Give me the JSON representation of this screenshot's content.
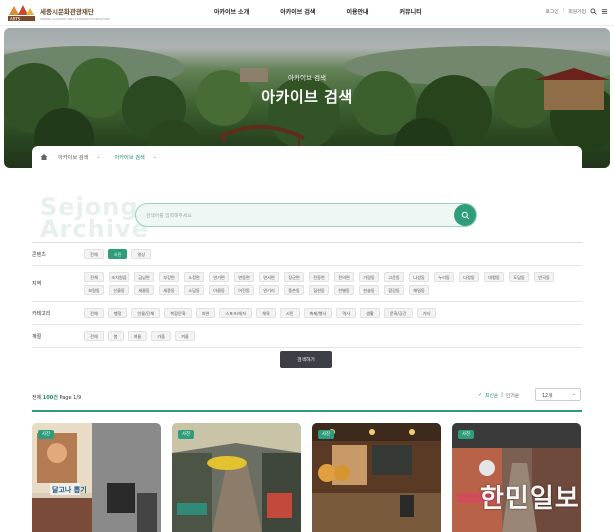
{
  "header": {
    "logo_title": "세종시문화관광재단",
    "logo_sub": "SEJONG CULTURE AND TOURISM FOUNDATION",
    "nav": [
      "아카이브 소개",
      "아카이브 검색",
      "이용안내",
      "커뮤니티"
    ],
    "login": "로그인",
    "join": "회원가입"
  },
  "hero": {
    "small": "아카이브 검색",
    "title": "아카이브 검색"
  },
  "breadcrumb": {
    "level1": "아카이브 검색",
    "level2": "아카이브 검색"
  },
  "watermark": [
    "Sejong",
    "Archive"
  ],
  "search": {
    "placeholder": "검색어를 입력해주세요"
  },
  "filters": {
    "content": {
      "label": "콘텐츠",
      "options": [
        "전체",
        "사진",
        "영상"
      ],
      "selected": "사진"
    },
    "region": {
      "label": "지역",
      "options": [
        "전체",
        "조치원읍",
        "금남면",
        "부강면",
        "소정면",
        "연기면",
        "연동면",
        "연서면",
        "장군면",
        "전동면",
        "전의면",
        "가람동",
        "고운동",
        "나성동",
        "누리동",
        "다정동",
        "대평동",
        "도담동",
        "반곡동",
        "보람동",
        "산울동",
        "새롬동",
        "세종동",
        "소담동",
        "아름동",
        "어진동",
        "연기리",
        "종촌동",
        "집현동",
        "한별동",
        "한솔동",
        "합강동",
        "해밀동"
      ]
    },
    "category": {
      "label": "카테고리",
      "options": [
        "전체",
        "행정",
        "인물/단체",
        "복합문화",
        "자연",
        "스포츠/레저",
        "체육",
        "시민",
        "축제/행사",
        "역사",
        "생활",
        "문화/공간",
        "기타"
      ]
    },
    "era": {
      "label": "계절",
      "options": [
        "전체",
        "봄",
        "여름",
        "가을",
        "겨울"
      ]
    }
  },
  "submit_label": "검색하기",
  "results": {
    "count_prefix": "전체",
    "count": "100건",
    "page": "Page 1/9",
    "sort_latest": "최신순",
    "sort_popular": "인기순",
    "per_page": "12개"
  },
  "cards": [
    {
      "badge": "사진",
      "sign": "달고나 뽑기"
    },
    {
      "badge": "사진"
    },
    {
      "badge": "사진"
    },
    {
      "badge": "사진"
    }
  ],
  "brand_watermark": "한민일보",
  "colors": {
    "accent": "#2f9c7c",
    "button_dark": "#3c3f45"
  }
}
